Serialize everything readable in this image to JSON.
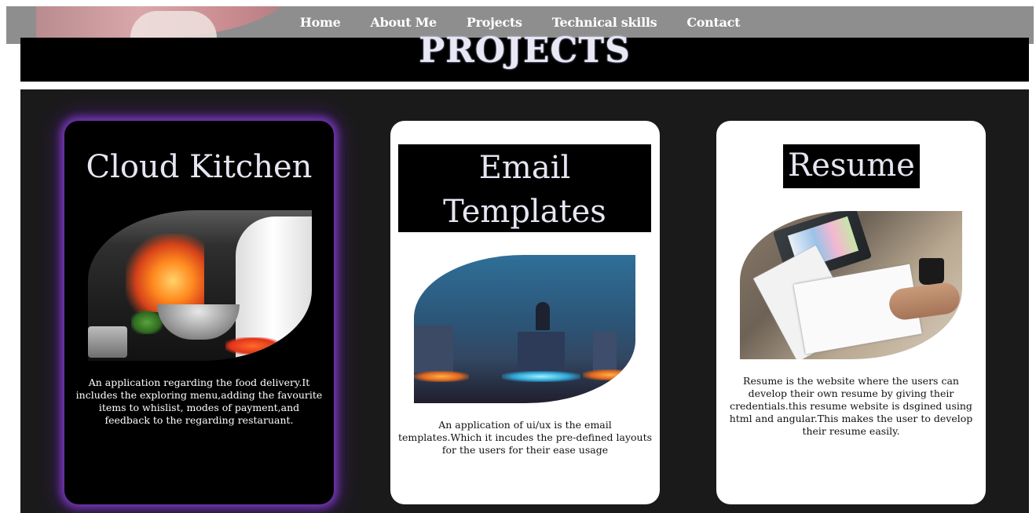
{
  "nav": {
    "items": [
      {
        "label": "Home"
      },
      {
        "label": "About Me"
      },
      {
        "label": "Projects"
      },
      {
        "label": "Technical skills"
      },
      {
        "label": "Contact"
      }
    ]
  },
  "section": {
    "title": "PROJECTS"
  },
  "projects": [
    {
      "title": "Cloud Kitchen",
      "description": "An application regarding the food delivery.It includes the exploring menu,adding the favourite items to whislist, modes of payment,and feedback to the regarding restaruant.",
      "image": "chef-cooking-flambe-photo"
    },
    {
      "title": "Email Templates",
      "description": "An application of ui/ux is the email templates.Which it incudes the pre-defined layouts for the users for their ease usage",
      "image": "neon-stage-photo"
    },
    {
      "title": "Resume",
      "description": "Resume is the website where the users can develop their own resume by giving their credentials.this resume website is dsgined using html and angular.This makes the user to develop their resume easily.",
      "image": "resume-documents-photo"
    }
  ],
  "colors": {
    "nav_bg": "#8e8e8e",
    "banner_bg": "#000000",
    "panel_bg": "#1b1a1b",
    "card_glow": "#803cc8",
    "title_text": "#e6e6f2"
  }
}
